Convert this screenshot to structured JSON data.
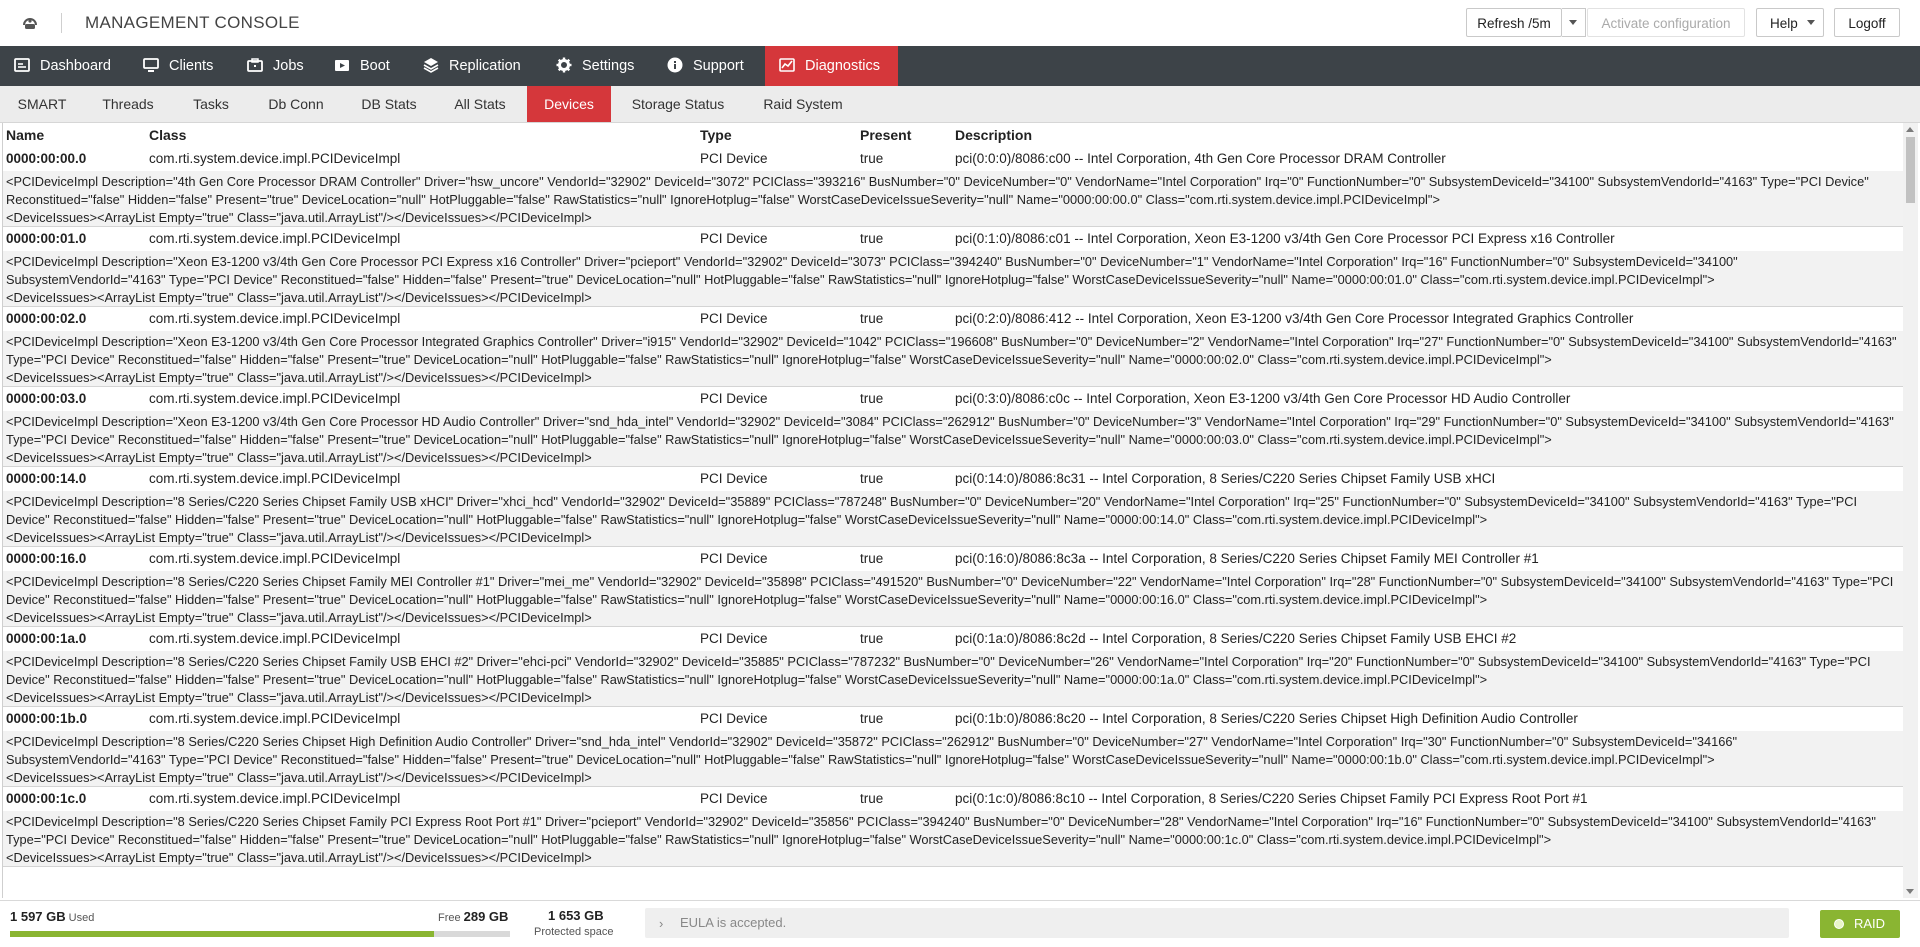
{
  "app": {
    "title": "MANAGEMENT CONSOLE"
  },
  "toolbar": {
    "refresh_label": "Refresh /5m",
    "activate_label": "Activate configuration",
    "help_label": "Help",
    "logoff_label": "Logoff"
  },
  "nav": {
    "items": [
      {
        "label": "Dashboard",
        "icon": "dashboard-icon"
      },
      {
        "label": "Clients",
        "icon": "monitor-icon"
      },
      {
        "label": "Jobs",
        "icon": "jobs-icon"
      },
      {
        "label": "Boot",
        "icon": "boot-icon"
      },
      {
        "label": "Replication",
        "icon": "layers-icon"
      },
      {
        "label": "Settings",
        "icon": "gear-icon"
      },
      {
        "label": "Support",
        "icon": "info-icon"
      },
      {
        "label": "Diagnostics",
        "icon": "chart-icon",
        "active": true
      }
    ]
  },
  "subnav": {
    "items": [
      {
        "label": "SMART"
      },
      {
        "label": "Threads"
      },
      {
        "label": "Tasks"
      },
      {
        "label": "Db Conn"
      },
      {
        "label": "DB Stats"
      },
      {
        "label": "All Stats"
      },
      {
        "label": "Devices",
        "active": true
      },
      {
        "label": "Storage Status"
      },
      {
        "label": "Raid System"
      }
    ]
  },
  "table": {
    "headers": {
      "name": "Name",
      "class": "Class",
      "type": "Type",
      "present": "Present",
      "description": "Description"
    },
    "rows": [
      {
        "name": "0000:00:00.0",
        "class": "com.rti.system.device.impl.PCIDeviceImpl",
        "type": "PCI Device",
        "present": "true",
        "description": "pci(0:0:0)/8086:c00 -- Intel Corporation, 4th Gen Core Processor DRAM Controller",
        "xml": "<PCIDeviceImpl Description=\"4th Gen Core Processor DRAM Controller\" Driver=\"hsw_uncore\" VendorId=\"32902\" DeviceId=\"3072\" PCIClass=\"393216\" BusNumber=\"0\" DeviceNumber=\"0\" VendorName=\"Intel Corporation\" Irq=\"0\" FunctionNumber=\"0\" SubsystemDeviceId=\"34100\" SubsystemVendorId=\"4163\" Type=\"PCI Device\" Reconstitued=\"false\" Hidden=\"false\" Present=\"true\" DeviceLocation=\"null\" HotPluggable=\"false\" RawStatistics=\"null\" IgnoreHotplug=\"false\" WorstCaseDeviceIssueSeverity=\"null\" Name=\"0000:00:00.0\" Class=\"com.rti.system.device.impl.PCIDeviceImpl\">\n<DeviceIssues><ArrayList Empty=\"true\" Class=\"java.util.ArrayList\"/></DeviceIssues></PCIDeviceImpl>"
      },
      {
        "name": "0000:00:01.0",
        "class": "com.rti.system.device.impl.PCIDeviceImpl",
        "type": "PCI Device",
        "present": "true",
        "description": "pci(0:1:0)/8086:c01 -- Intel Corporation, Xeon E3-1200 v3/4th Gen Core Processor PCI Express x16 Controller",
        "xml": "<PCIDeviceImpl Description=\"Xeon E3-1200 v3/4th Gen Core Processor PCI Express x16 Controller\" Driver=\"pcieport\" VendorId=\"32902\" DeviceId=\"3073\" PCIClass=\"394240\" BusNumber=\"0\" DeviceNumber=\"1\" VendorName=\"Intel Corporation\" Irq=\"16\" FunctionNumber=\"0\" SubsystemDeviceId=\"34100\" SubsystemVendorId=\"4163\" Type=\"PCI Device\" Reconstitued=\"false\" Hidden=\"false\" Present=\"true\" DeviceLocation=\"null\" HotPluggable=\"false\" RawStatistics=\"null\" IgnoreHotplug=\"false\" WorstCaseDeviceIssueSeverity=\"null\" Name=\"0000:00:01.0\" Class=\"com.rti.system.device.impl.PCIDeviceImpl\">\n<DeviceIssues><ArrayList Empty=\"true\" Class=\"java.util.ArrayList\"/></DeviceIssues></PCIDeviceImpl>"
      },
      {
        "name": "0000:00:02.0",
        "class": "com.rti.system.device.impl.PCIDeviceImpl",
        "type": "PCI Device",
        "present": "true",
        "description": "pci(0:2:0)/8086:412 -- Intel Corporation, Xeon E3-1200 v3/4th Gen Core Processor Integrated Graphics Controller",
        "xml": "<PCIDeviceImpl Description=\"Xeon E3-1200 v3/4th Gen Core Processor Integrated Graphics Controller\" Driver=\"i915\" VendorId=\"32902\" DeviceId=\"1042\" PCIClass=\"196608\" BusNumber=\"0\" DeviceNumber=\"2\" VendorName=\"Intel Corporation\" Irq=\"27\" FunctionNumber=\"0\" SubsystemDeviceId=\"34100\" SubsystemVendorId=\"4163\" Type=\"PCI Device\" Reconstitued=\"false\" Hidden=\"false\" Present=\"true\" DeviceLocation=\"null\" HotPluggable=\"false\" RawStatistics=\"null\" IgnoreHotplug=\"false\" WorstCaseDeviceIssueSeverity=\"null\" Name=\"0000:00:02.0\" Class=\"com.rti.system.device.impl.PCIDeviceImpl\">\n<DeviceIssues><ArrayList Empty=\"true\" Class=\"java.util.ArrayList\"/></DeviceIssues></PCIDeviceImpl>"
      },
      {
        "name": "0000:00:03.0",
        "class": "com.rti.system.device.impl.PCIDeviceImpl",
        "type": "PCI Device",
        "present": "true",
        "description": "pci(0:3:0)/8086:c0c -- Intel Corporation, Xeon E3-1200 v3/4th Gen Core Processor HD Audio Controller",
        "xml": "<PCIDeviceImpl Description=\"Xeon E3-1200 v3/4th Gen Core Processor HD Audio Controller\" Driver=\"snd_hda_intel\" VendorId=\"32902\" DeviceId=\"3084\" PCIClass=\"262912\" BusNumber=\"0\" DeviceNumber=\"3\" VendorName=\"Intel Corporation\" Irq=\"29\" FunctionNumber=\"0\" SubsystemDeviceId=\"34100\" SubsystemVendorId=\"4163\" Type=\"PCI Device\" Reconstitued=\"false\" Hidden=\"false\" Present=\"true\" DeviceLocation=\"null\" HotPluggable=\"false\" RawStatistics=\"null\" IgnoreHotplug=\"false\" WorstCaseDeviceIssueSeverity=\"null\" Name=\"0000:00:03.0\" Class=\"com.rti.system.device.impl.PCIDeviceImpl\">\n<DeviceIssues><ArrayList Empty=\"true\" Class=\"java.util.ArrayList\"/></DeviceIssues></PCIDeviceImpl>"
      },
      {
        "name": "0000:00:14.0",
        "class": "com.rti.system.device.impl.PCIDeviceImpl",
        "type": "PCI Device",
        "present": "true",
        "description": "pci(0:14:0)/8086:8c31 -- Intel Corporation, 8 Series/C220 Series Chipset Family USB xHCI",
        "xml": "<PCIDeviceImpl Description=\"8 Series/C220 Series Chipset Family USB xHCI\" Driver=\"xhci_hcd\" VendorId=\"32902\" DeviceId=\"35889\" PCIClass=\"787248\" BusNumber=\"0\" DeviceNumber=\"20\" VendorName=\"Intel Corporation\" Irq=\"25\" FunctionNumber=\"0\" SubsystemDeviceId=\"34100\" SubsystemVendorId=\"4163\" Type=\"PCI Device\" Reconstitued=\"false\" Hidden=\"false\" Present=\"true\" DeviceLocation=\"null\" HotPluggable=\"false\" RawStatistics=\"null\" IgnoreHotplug=\"false\" WorstCaseDeviceIssueSeverity=\"null\" Name=\"0000:00:14.0\" Class=\"com.rti.system.device.impl.PCIDeviceImpl\">\n<DeviceIssues><ArrayList Empty=\"true\" Class=\"java.util.ArrayList\"/></DeviceIssues></PCIDeviceImpl>"
      },
      {
        "name": "0000:00:16.0",
        "class": "com.rti.system.device.impl.PCIDeviceImpl",
        "type": "PCI Device",
        "present": "true",
        "description": "pci(0:16:0)/8086:8c3a -- Intel Corporation, 8 Series/C220 Series Chipset Family MEI Controller #1",
        "xml": "<PCIDeviceImpl Description=\"8 Series/C220 Series Chipset Family MEI Controller #1\" Driver=\"mei_me\" VendorId=\"32902\" DeviceId=\"35898\" PCIClass=\"491520\" BusNumber=\"0\" DeviceNumber=\"22\" VendorName=\"Intel Corporation\" Irq=\"28\" FunctionNumber=\"0\" SubsystemDeviceId=\"34100\" SubsystemVendorId=\"4163\" Type=\"PCI Device\" Reconstitued=\"false\" Hidden=\"false\" Present=\"true\" DeviceLocation=\"null\" HotPluggable=\"false\" RawStatistics=\"null\" IgnoreHotplug=\"false\" WorstCaseDeviceIssueSeverity=\"null\" Name=\"0000:00:16.0\" Class=\"com.rti.system.device.impl.PCIDeviceImpl\">\n<DeviceIssues><ArrayList Empty=\"true\" Class=\"java.util.ArrayList\"/></DeviceIssues></PCIDeviceImpl>"
      },
      {
        "name": "0000:00:1a.0",
        "class": "com.rti.system.device.impl.PCIDeviceImpl",
        "type": "PCI Device",
        "present": "true",
        "description": "pci(0:1a:0)/8086:8c2d -- Intel Corporation, 8 Series/C220 Series Chipset Family USB EHCI #2",
        "xml": "<PCIDeviceImpl Description=\"8 Series/C220 Series Chipset Family USB EHCI #2\" Driver=\"ehci-pci\" VendorId=\"32902\" DeviceId=\"35885\" PCIClass=\"787232\" BusNumber=\"0\" DeviceNumber=\"26\" VendorName=\"Intel Corporation\" Irq=\"20\" FunctionNumber=\"0\" SubsystemDeviceId=\"34100\" SubsystemVendorId=\"4163\" Type=\"PCI Device\" Reconstitued=\"false\" Hidden=\"false\" Present=\"true\" DeviceLocation=\"null\" HotPluggable=\"false\" RawStatistics=\"null\" IgnoreHotplug=\"false\" WorstCaseDeviceIssueSeverity=\"null\" Name=\"0000:00:1a.0\" Class=\"com.rti.system.device.impl.PCIDeviceImpl\">\n<DeviceIssues><ArrayList Empty=\"true\" Class=\"java.util.ArrayList\"/></DeviceIssues></PCIDeviceImpl>"
      },
      {
        "name": "0000:00:1b.0",
        "class": "com.rti.system.device.impl.PCIDeviceImpl",
        "type": "PCI Device",
        "present": "true",
        "description": "pci(0:1b:0)/8086:8c20 -- Intel Corporation, 8 Series/C220 Series Chipset High Definition Audio Controller",
        "xml": "<PCIDeviceImpl Description=\"8 Series/C220 Series Chipset High Definition Audio Controller\" Driver=\"snd_hda_intel\" VendorId=\"32902\" DeviceId=\"35872\" PCIClass=\"262912\" BusNumber=\"0\" DeviceNumber=\"27\" VendorName=\"Intel Corporation\" Irq=\"30\" FunctionNumber=\"0\" SubsystemDeviceId=\"34166\" SubsystemVendorId=\"4163\" Type=\"PCI Device\" Reconstitued=\"false\" Hidden=\"false\" Present=\"true\" DeviceLocation=\"null\" HotPluggable=\"false\" RawStatistics=\"null\" IgnoreHotplug=\"false\" WorstCaseDeviceIssueSeverity=\"null\" Name=\"0000:00:1b.0\" Class=\"com.rti.system.device.impl.PCIDeviceImpl\">\n<DeviceIssues><ArrayList Empty=\"true\" Class=\"java.util.ArrayList\"/></DeviceIssues></PCIDeviceImpl>"
      },
      {
        "name": "0000:00:1c.0",
        "class": "com.rti.system.device.impl.PCIDeviceImpl",
        "type": "PCI Device",
        "present": "true",
        "description": "pci(0:1c:0)/8086:8c10 -- Intel Corporation, 8 Series/C220 Series Chipset Family PCI Express Root Port #1",
        "xml": "<PCIDeviceImpl Description=\"8 Series/C220 Series Chipset Family PCI Express Root Port #1\" Driver=\"pcieport\" VendorId=\"32902\" DeviceId=\"35856\" PCIClass=\"394240\" BusNumber=\"0\" DeviceNumber=\"28\" VendorName=\"Intel Corporation\" Irq=\"16\" FunctionNumber=\"0\" SubsystemDeviceId=\"34100\" SubsystemVendorId=\"4163\" Type=\"PCI Device\" Reconstitued=\"false\" Hidden=\"false\" Present=\"true\" DeviceLocation=\"null\" HotPluggable=\"false\" RawStatistics=\"null\" IgnoreHotplug=\"false\" WorstCaseDeviceIssueSeverity=\"null\" Name=\"0000:00:1c.0\" Class=\"com.rti.system.device.impl.PCIDeviceImpl\">\n<DeviceIssues><ArrayList Empty=\"true\" Class=\"java.util.ArrayList\"/></DeviceIssues></PCIDeviceImpl>"
      }
    ]
  },
  "footer": {
    "used_value": "1 597 GB",
    "used_label": "Used",
    "free_label": "Free",
    "free_value": "289 GB",
    "usage_fraction": 0.847,
    "protected_value": "1 653 GB",
    "protected_label": "Protected space",
    "eula_text": "EULA is accepted.",
    "raid_label": "RAID"
  },
  "colors": {
    "accent": "#d5373b",
    "nav_bg": "#3d4348",
    "ok_green": "#8ab532"
  }
}
